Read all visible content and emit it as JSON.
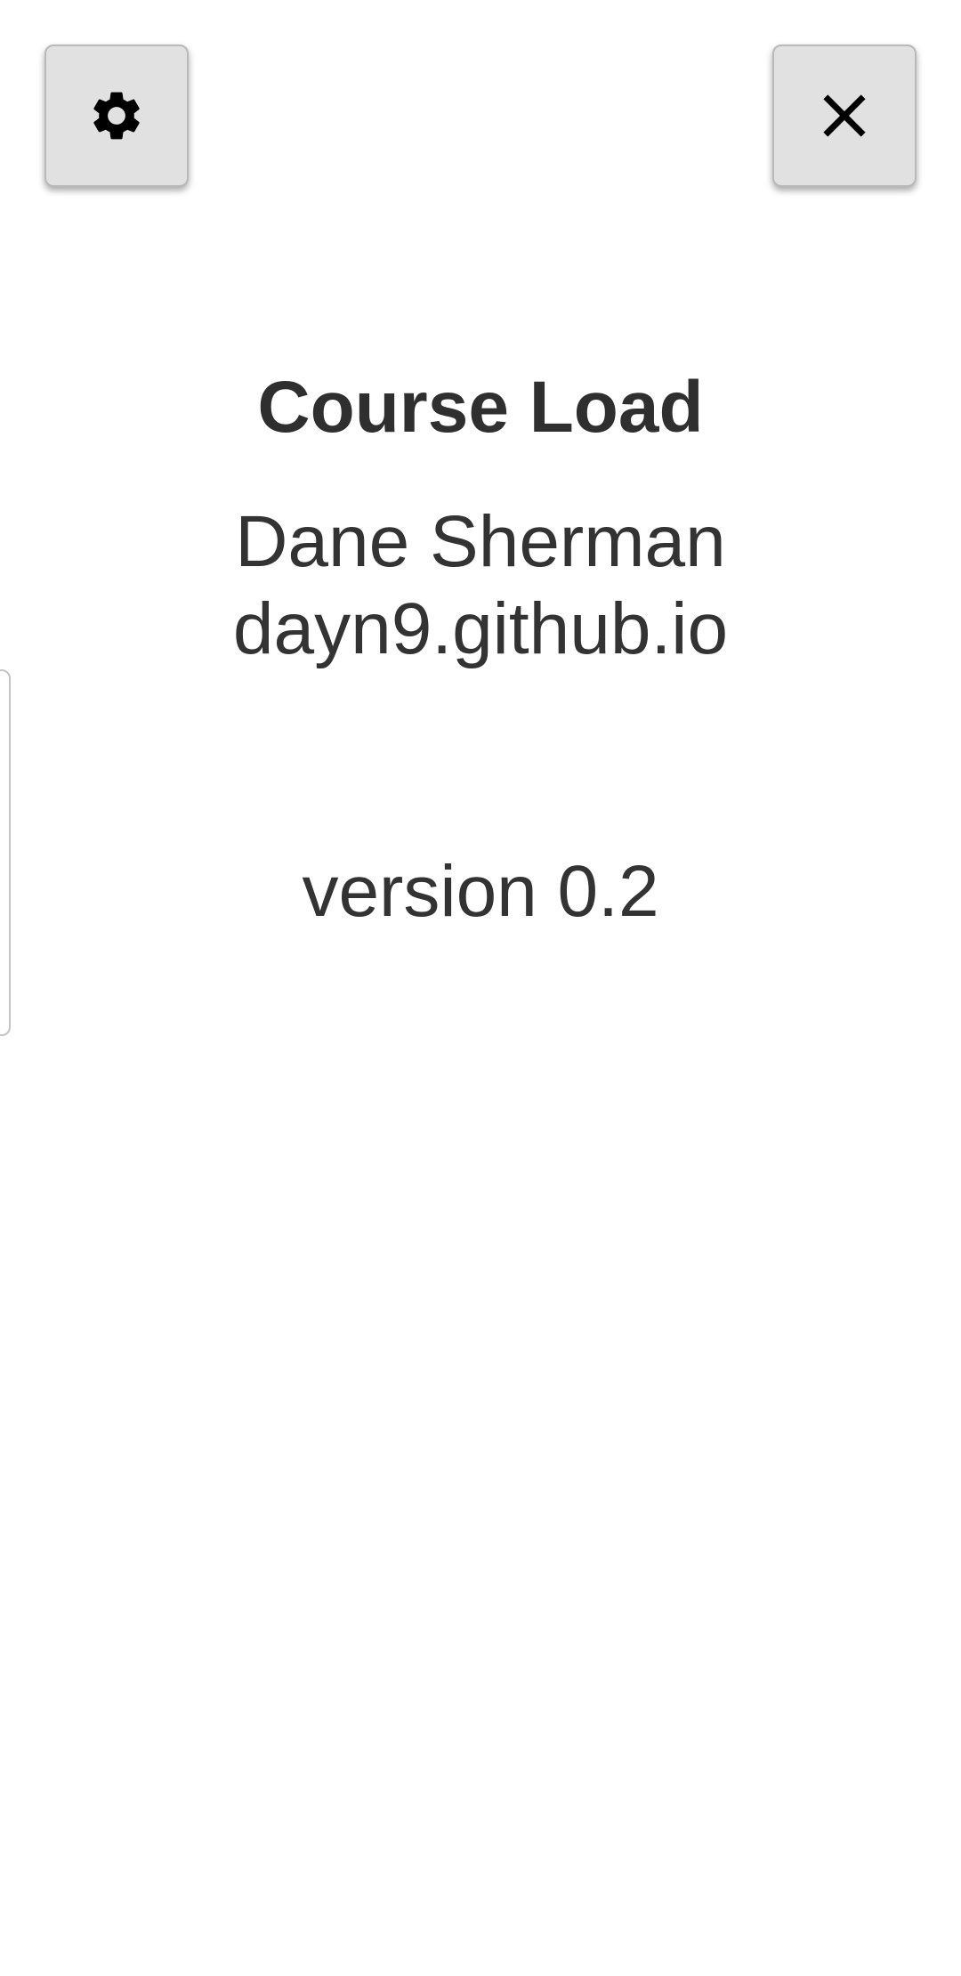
{
  "toolbar": {
    "settings_icon": "gear-icon",
    "close_icon": "close-icon"
  },
  "about": {
    "title": "Course Load",
    "author": "Dane Sherman",
    "website": "dayn9.github.io",
    "version": "version 0.2"
  },
  "colors": {
    "button_bg": "#e1e1e1",
    "text": "#333333",
    "background": "#ffffff"
  }
}
